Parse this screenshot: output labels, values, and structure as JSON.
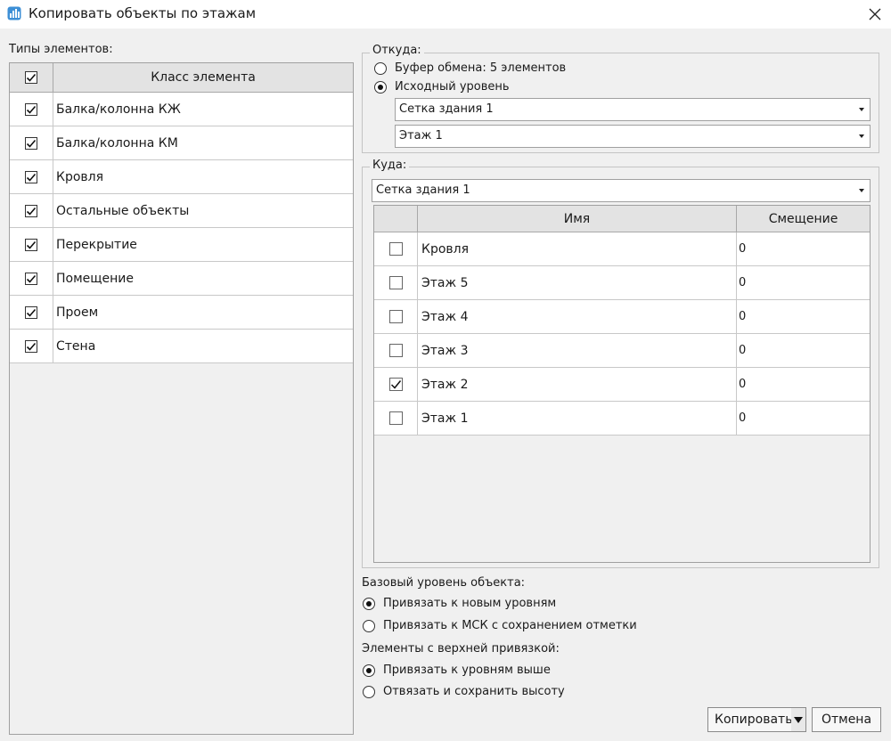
{
  "window": {
    "title": "Копировать объекты по этажам",
    "close_icon": "close-icon"
  },
  "left": {
    "label": "Типы элементов:",
    "header": {
      "all_checked": true,
      "column": "Класс элемента"
    },
    "rows": [
      {
        "name": "Балка/колонна КЖ",
        "checked": true
      },
      {
        "name": "Балка/колонна КМ",
        "checked": true
      },
      {
        "name": "Кровля",
        "checked": true
      },
      {
        "name": "Остальные объекты",
        "checked": true
      },
      {
        "name": "Перекрытие",
        "checked": true
      },
      {
        "name": "Помещение",
        "checked": true
      },
      {
        "name": "Проем",
        "checked": true
      },
      {
        "name": "Стена",
        "checked": true
      }
    ]
  },
  "source": {
    "legend": "Откуда:",
    "option_clipboard": "Буфер обмена: 5 элементов",
    "option_level": "Исходный уровень",
    "selected": "level",
    "grid_combo": "Сетка здания 1",
    "floor_combo": "Этаж 1"
  },
  "target": {
    "legend": "Куда:",
    "grid_combo": "Сетка здания 1",
    "columns": {
      "name": "Имя",
      "offset": "Смещение"
    },
    "rows": [
      {
        "name": "Кровля",
        "offset": "0",
        "checked": false
      },
      {
        "name": "Этаж 5",
        "offset": "0",
        "checked": false
      },
      {
        "name": "Этаж 4",
        "offset": "0",
        "checked": false
      },
      {
        "name": "Этаж 3",
        "offset": "0",
        "checked": false
      },
      {
        "name": "Этаж 2",
        "offset": "0",
        "checked": true
      },
      {
        "name": "Этаж 1",
        "offset": "0",
        "checked": false
      }
    ]
  },
  "base_level": {
    "label": "Базовый уровень объекта:",
    "option_new": "Привязать к новым уровням",
    "option_msk": "Привязать к МСК с сохранением отметки",
    "selected": "new"
  },
  "top_binding": {
    "label": "Элементы с верхней привязкой:",
    "option_above": "Привязать к уровням выше",
    "option_keep": "Отвязать и сохранить высоту",
    "selected": "above"
  },
  "buttons": {
    "copy": "Копировать",
    "cancel": "Отмена"
  }
}
